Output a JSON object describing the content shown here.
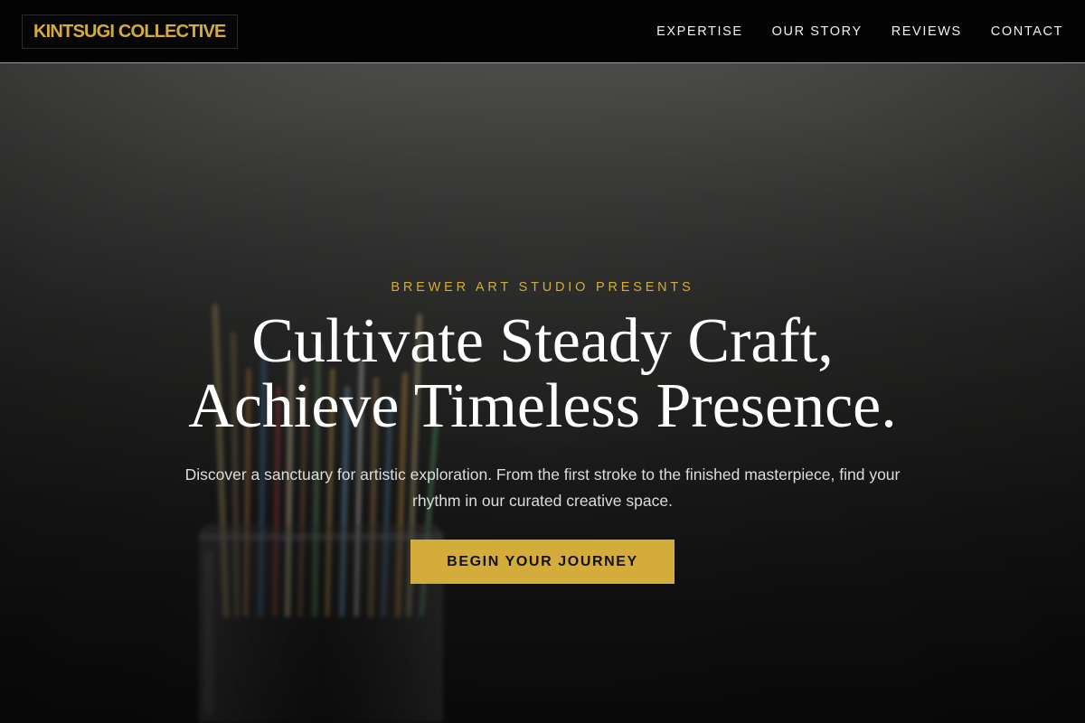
{
  "header": {
    "logo_text": "KINTSUGI COLLECTIVE",
    "nav": [
      {
        "label": "EXPERTISE"
      },
      {
        "label": "OUR STORY"
      },
      {
        "label": "REVIEWS"
      },
      {
        "label": "CONTACT"
      }
    ]
  },
  "hero": {
    "eyebrow": "BREWER ART STUDIO PRESENTS",
    "title_line_1": "Cultivate Steady Craft,",
    "title_line_2": "Achieve Timeless Presence.",
    "subtitle": "Discover a sanctuary for artistic exploration. From the first stroke to the finished masterpiece, find your rhythm in our curated creative space.",
    "cta_label": "BEGIN YOUR JOURNEY",
    "background_image": "paintbrushes-in-glass-jar-photo"
  },
  "colors": {
    "accent_gold": "#d4ac3c",
    "header_bg": "#030303",
    "hero_text": "#ffffff",
    "hero_subtext": "#dcdcdc"
  }
}
